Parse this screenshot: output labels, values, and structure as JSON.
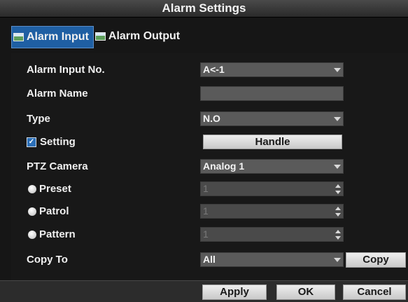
{
  "window": {
    "title": "Alarm Settings"
  },
  "tabs": [
    {
      "label": "Alarm Input",
      "icon": "tab-picture-icon",
      "active": true
    },
    {
      "label": "Alarm Output",
      "icon": "tab-picture-icon",
      "active": false
    }
  ],
  "form": {
    "alarm_input_no": {
      "label": "Alarm Input No.",
      "value": "A<-1"
    },
    "alarm_name": {
      "label": "Alarm Name",
      "value": ""
    },
    "type": {
      "label": "Type",
      "value": "N.O"
    },
    "setting": {
      "label": "Setting",
      "checked": true,
      "button_label": "Handle"
    },
    "ptz_camera": {
      "label": "PTZ Camera",
      "value": "Analog 1"
    },
    "preset": {
      "label": "Preset",
      "value": "1"
    },
    "patrol": {
      "label": "Patrol",
      "value": "1"
    },
    "pattern": {
      "label": "Pattern",
      "value": "1"
    },
    "copy_to": {
      "label": "Copy To",
      "value": "All",
      "button_label": "Copy"
    }
  },
  "footer": {
    "apply_label": "Apply",
    "ok_label": "OK",
    "cancel_label": "Cancel"
  },
  "colors": {
    "tab_active": "#1f5fa3",
    "field_bg": "#5a5a5a",
    "button_bg": "#d9d9d9"
  }
}
